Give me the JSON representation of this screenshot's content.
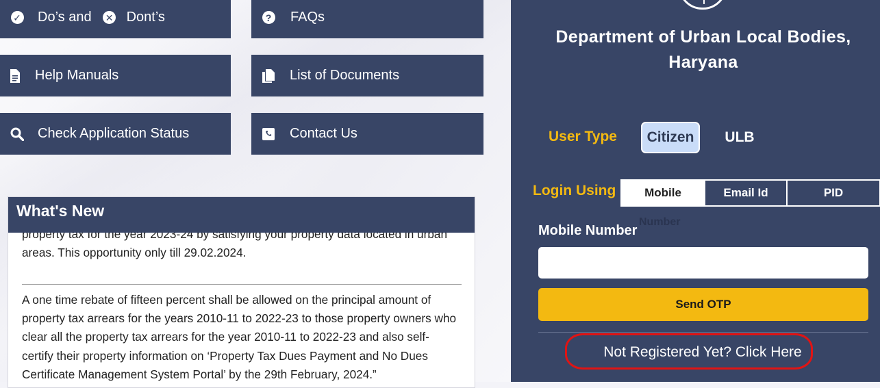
{
  "tiles": {
    "dos": "Do’s and",
    "donts": "Dont’s",
    "faqs": "FAQs",
    "help": "Help Manuals",
    "docs": "List of Documents",
    "status": "Check Application Status",
    "contact": "Contact Us"
  },
  "news": {
    "title": "What's New",
    "item1": "property tax for the year 2023-24 by satisfying your property data located in urban areas. This opportunity only till 29.02.2024.",
    "item2": "A one time rebate of fifteen percent shall be allowed on the principal amount of property tax arrears for the years 2010-11 to 2022-23 to those property owners who clear all the property tax arrears for the year 2010-11 to 2022-23 and also self-certify their property information on ‘Property Tax Dues Payment and No Dues Certificate Management System Portal’ by the 29th February, 2024.”"
  },
  "login": {
    "department": "Department of Urban Local Bodies, Haryana",
    "user_type_label": "User Type",
    "user_types": [
      "Citizen",
      "ULB"
    ],
    "login_using_label": "Login Using",
    "login_options": [
      "Mobile",
      "Email Id",
      "PID"
    ],
    "login_option_overflow": "Number",
    "mobile_label": "Mobile Number",
    "mobile_value": "",
    "send_otp": "Send OTP",
    "register_link": "Not Registered Yet? Click Here"
  },
  "colors": {
    "tile_bg": "#384566",
    "accent_yellow": "#f3b911",
    "highlight_red": "#e01414"
  }
}
